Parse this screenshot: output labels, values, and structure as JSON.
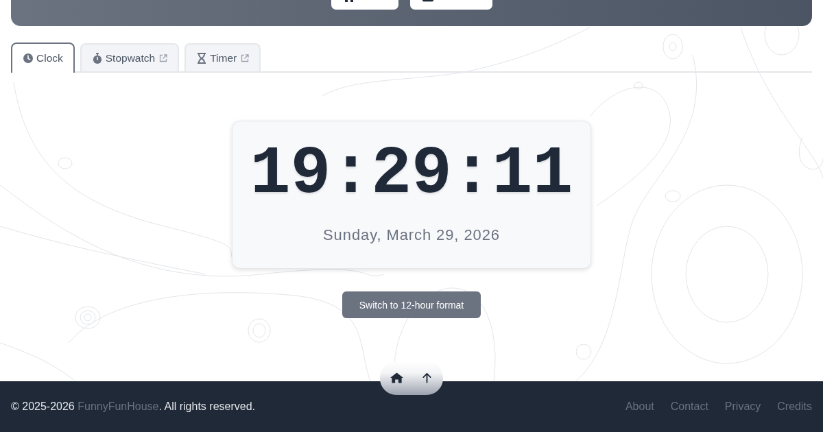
{
  "tabs": [
    {
      "label": "Clock",
      "selected": true,
      "external": false
    },
    {
      "label": "Stopwatch",
      "selected": false,
      "external": true
    },
    {
      "label": "Timer",
      "selected": false,
      "external": true
    }
  ],
  "clock": {
    "time": "19:29:11",
    "date": "Sunday, March 29, 2026"
  },
  "format_button": {
    "label": "Switch to 12-hour format"
  },
  "footer": {
    "copyright_prefix": "© 2025-2026 ",
    "brand": "FunnyFunHouse",
    "copyright_suffix": ". All rights reserved.",
    "links": [
      "About",
      "Contact",
      "Privacy",
      "Credits"
    ]
  }
}
